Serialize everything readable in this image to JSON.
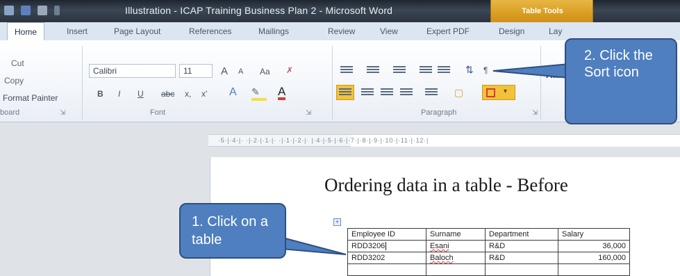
{
  "window": {
    "title": "Illustration - ICAP Training Business Plan 2 - Microsoft Word",
    "context_tab": "Table Tools"
  },
  "ribbon_tabs": [
    {
      "label": "Home",
      "active": true
    },
    {
      "label": "Insert"
    },
    {
      "label": "Page Layout"
    },
    {
      "label": "References"
    },
    {
      "label": "Mailings"
    },
    {
      "label": "Review"
    },
    {
      "label": "View"
    },
    {
      "label": "Expert PDF"
    },
    {
      "label": "Design"
    },
    {
      "label": "Lay"
    }
  ],
  "clipboard": {
    "items": [
      "Cut",
      "Copy",
      "Format Painter"
    ],
    "group_label": "board"
  },
  "font": {
    "name": "Calibri",
    "size": "11",
    "grow": "A",
    "shrink": "A",
    "case": "Aa",
    "bold": "B",
    "italic": "I",
    "underline": "U",
    "strike": "abc",
    "subscript": "x,",
    "superscript": "x'",
    "group_label": "Font"
  },
  "paragraph": {
    "group_label": "Paragraph"
  },
  "styles": {
    "preview": "AaI"
  },
  "ruler": {
    "text": "·5·|·4·|· ·|·2·|·1·|· ·|·1·|·2·|· |·4·|·5·|·6·|·7·|·8·|·9·|·10·|·11·|·12·|"
  },
  "document": {
    "heading": "Ordering data in a table - Before",
    "table": {
      "headers": [
        "Employee ID",
        "Surname",
        "Department",
        "Salary"
      ],
      "rows": [
        [
          "RDD3206",
          "Esani",
          "R&D",
          "36,000"
        ],
        [
          "RDD3202",
          "Baloch",
          "R&D",
          "160,000"
        ]
      ]
    }
  },
  "callouts": {
    "sort": "2. Click the Sort icon",
    "table": "1. Click on a table"
  },
  "colors": {
    "callout_fill": "#4f7fbf",
    "callout_border": "#2d4f7f",
    "context_tab": "#d69b1d",
    "highlight": "#f3c23a"
  }
}
